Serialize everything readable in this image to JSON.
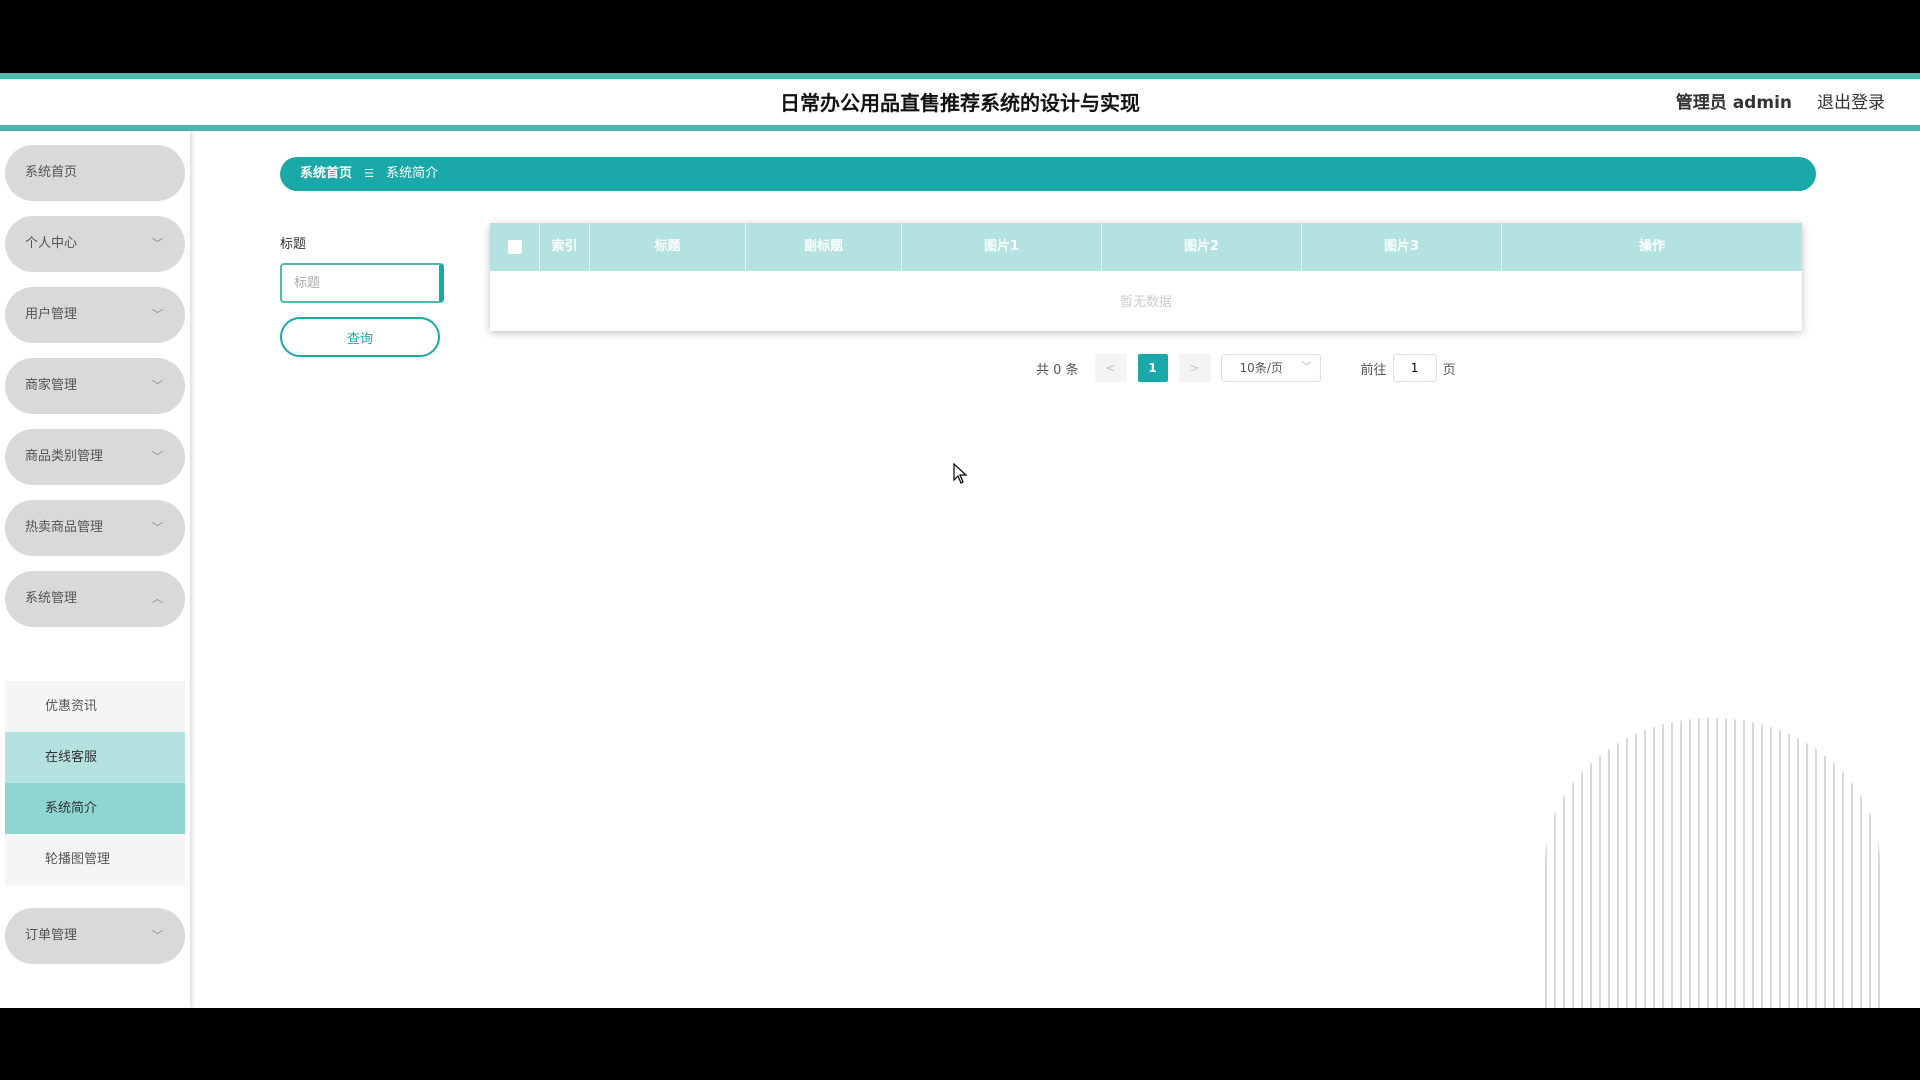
{
  "header": {
    "title": "日常办公用品直售推荐系统的设计与实现",
    "user": "管理员 admin",
    "logout": "退出登录"
  },
  "sidebar": {
    "items": [
      {
        "label": "系统首页"
      },
      {
        "label": "个人中心"
      },
      {
        "label": "用户管理"
      },
      {
        "label": "商家管理"
      },
      {
        "label": "商品类别管理"
      },
      {
        "label": "热卖商品管理"
      },
      {
        "label": "系统管理"
      },
      {
        "label": "订单管理"
      }
    ],
    "submenu": [
      {
        "label": "优惠资讯"
      },
      {
        "label": "在线客服"
      },
      {
        "label": "系统简介"
      },
      {
        "label": "轮播图管理"
      }
    ]
  },
  "breadcrumb": {
    "home": "系统首页",
    "separator": "☰",
    "current": "系统简介"
  },
  "search": {
    "label": "标题",
    "placeholder": "标题",
    "button": "查询"
  },
  "table": {
    "columns": [
      "索引",
      "标题",
      "副标题",
      "图片1",
      "图片2",
      "图片3",
      "操作"
    ],
    "empty_text": "暂无数据"
  },
  "pagination": {
    "total": "共 0 条",
    "prev": "<",
    "current_page": "1",
    "next": ">",
    "page_size": "10条/页",
    "goto_label": "前往",
    "goto_value": "1",
    "page_suffix": "页"
  },
  "colors": {
    "accent": "#1aa8a8",
    "accent_light": "#b4e2e0",
    "menu_bg": "#d9d9d9"
  }
}
